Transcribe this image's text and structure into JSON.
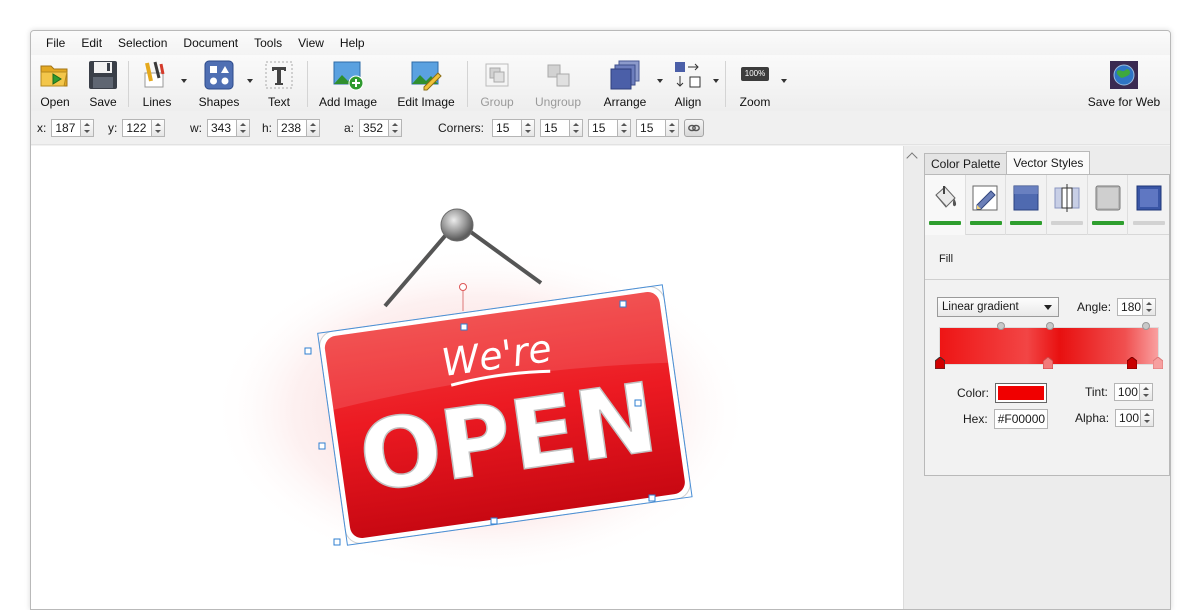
{
  "menu": [
    "File",
    "Edit",
    "Selection",
    "Document",
    "Tools",
    "View",
    "Help"
  ],
  "toolbar": {
    "open": "Open",
    "save": "Save",
    "lines": "Lines",
    "shapes": "Shapes",
    "text": "Text",
    "add_image": "Add Image",
    "edit_image": "Edit Image",
    "group": "Group",
    "ungroup": "Ungroup",
    "arrange": "Arrange",
    "align": "Align",
    "zoom": "Zoom",
    "zoom_badge": "100%",
    "save_for_web": "Save for Web"
  },
  "props": {
    "x_label": "x:",
    "x": "187",
    "y_label": "y:",
    "y": "122",
    "w_label": "w:",
    "w": "343",
    "h_label": "h:",
    "h": "238",
    "a_label": "a:",
    "a": "352",
    "corners_label": "Corners:",
    "corners": [
      "15",
      "15",
      "15",
      "15"
    ]
  },
  "panel": {
    "tabs": [
      "Color Palette",
      "Vector Styles"
    ],
    "active_tab": "Vector Styles",
    "style_icons": [
      "fill-bucket-icon",
      "pen-stroke-icon",
      "shape-style-icon",
      "border-style-icon",
      "shadow-style-icon",
      "bevel-style-icon"
    ],
    "fill_label": "Fill",
    "gradient_type": "Linear gradient",
    "angle_label": "Angle:",
    "angle": "180",
    "color_label": "Color:",
    "color_value": "#F00000",
    "hex_label": "Hex:",
    "hex": "#F00000",
    "tint_label": "Tint:",
    "tint": "100",
    "alpha_label": "Alpha:",
    "alpha": "100"
  },
  "sign": {
    "top_text": "We're",
    "main_text": "OPEN",
    "color": "#e8101c"
  },
  "colors": {
    "active_green": "#2e9e2e",
    "inactive_bar": "#d2d2d2"
  }
}
